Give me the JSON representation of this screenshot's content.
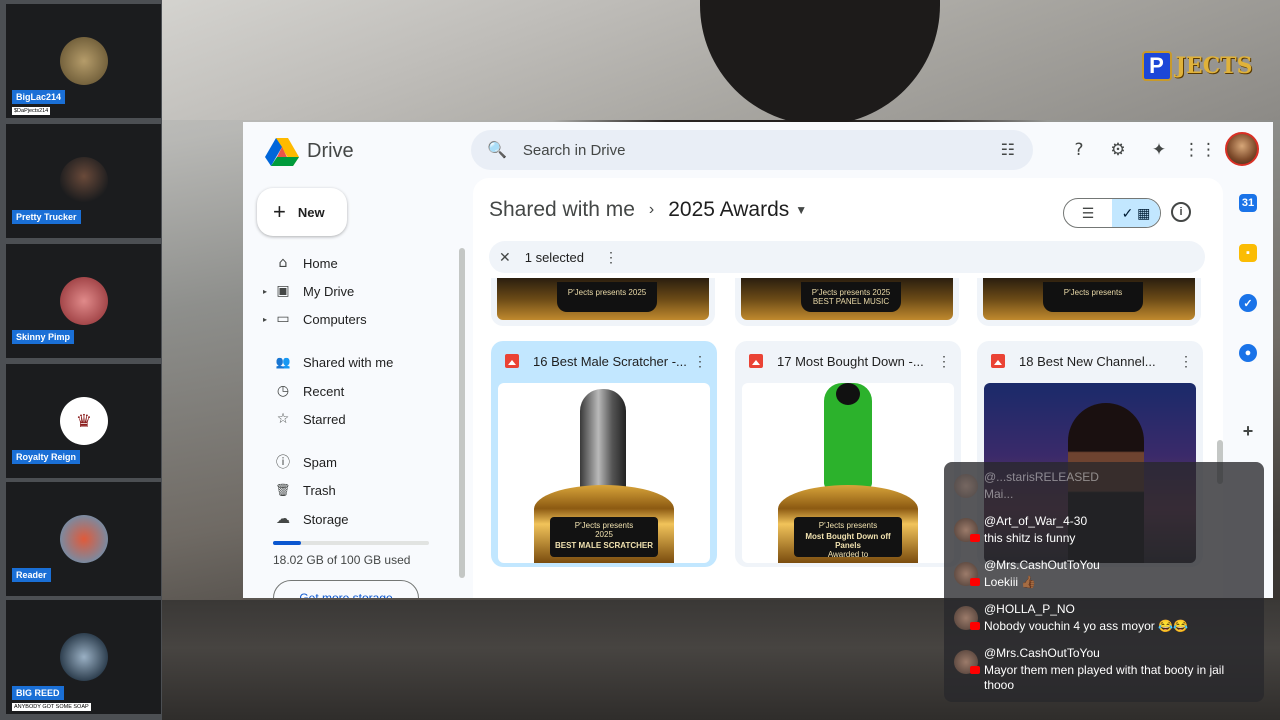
{
  "participants": [
    {
      "name": "BigLac214",
      "sub": "$DaPjects214",
      "avatar_color": "#6b6a4a"
    },
    {
      "name": "Pretty Trucker",
      "sub": "",
      "avatar_color": "#1b1c1e"
    },
    {
      "name": "Skinny Pimp",
      "sub": "",
      "avatar_color": "#a4474a"
    },
    {
      "name": "Royalty Reign",
      "sub": "",
      "avatar_color": "#ffffff"
    },
    {
      "name": "Reader",
      "sub": "",
      "avatar_color": "#7b8aa0"
    },
    {
      "name": "BIG REED",
      "sub": "ANYBODY GOT SOME SOAP",
      "avatar_color": "#2f4050"
    }
  ],
  "logo": {
    "mark": "P",
    "word": "JECTS"
  },
  "drive": {
    "app_title": "Drive",
    "search_placeholder": "Search in Drive",
    "new_label": "New",
    "nav": [
      {
        "label": "Home",
        "icon": "home-icon",
        "glyph": "⌂"
      },
      {
        "label": "My Drive",
        "icon": "drive-icon",
        "glyph": "▣"
      },
      {
        "label": "Computers",
        "icon": "computer-icon",
        "glyph": "▭"
      },
      {
        "label": "Shared with me",
        "icon": "people-icon",
        "glyph": "👥"
      },
      {
        "label": "Recent",
        "icon": "clock-icon",
        "glyph": "◷"
      },
      {
        "label": "Starred",
        "icon": "star-icon",
        "glyph": "☆"
      },
      {
        "label": "Spam",
        "icon": "spam-icon",
        "glyph": "ⓘ"
      },
      {
        "label": "Trash",
        "icon": "trash-icon",
        "glyph": "🗑"
      },
      {
        "label": "Storage",
        "icon": "cloud-icon",
        "glyph": "☁"
      }
    ],
    "storage_text": "18.02 GB of 100 GB used",
    "storage_used_fraction": 0.18,
    "more_storage_label": "Get more storage",
    "breadcrumb": {
      "parent": "Shared with me",
      "current": "2025 Awards"
    },
    "selection": {
      "count_label": "1 selected"
    },
    "top_cards": [
      {
        "plate": "P'Jects presents 2025"
      },
      {
        "plate": "P'Jects presents 2025 BEST PANEL MUSIC"
      },
      {
        "plate": "P'Jects presents"
      }
    ],
    "cards": [
      {
        "title": "16 Best Male Scratcher -...",
        "plate_top": "P'Jects presents",
        "plate_year": "2025",
        "plate_big": "BEST MALE SCRATCHER",
        "selected": true
      },
      {
        "title": "17 Most Bought Down -...",
        "plate_top": "P'Jects presents",
        "plate_year": "",
        "plate_big": "Most Bought Down off Panels",
        "plate_sub": "Awarded to",
        "selected": false
      },
      {
        "title": "18 Best New Channel...",
        "selected": false
      }
    ]
  },
  "chat": [
    {
      "user": "@...starisRELEASED",
      "text": "Mai..."
    },
    {
      "user": "@Art_of_War_4-30",
      "text": "this shitz is funny"
    },
    {
      "user": "@Mrs.CashOutToYou",
      "text": "Loekiii 👍🏾"
    },
    {
      "user": "@HOLLA_P_NO",
      "text": "Nobody vouchin 4 yo ass moyor 😂😂"
    },
    {
      "user": "@Mrs.CashOutToYou",
      "text": "Mayor them men played with that booty in jail thooo"
    }
  ]
}
